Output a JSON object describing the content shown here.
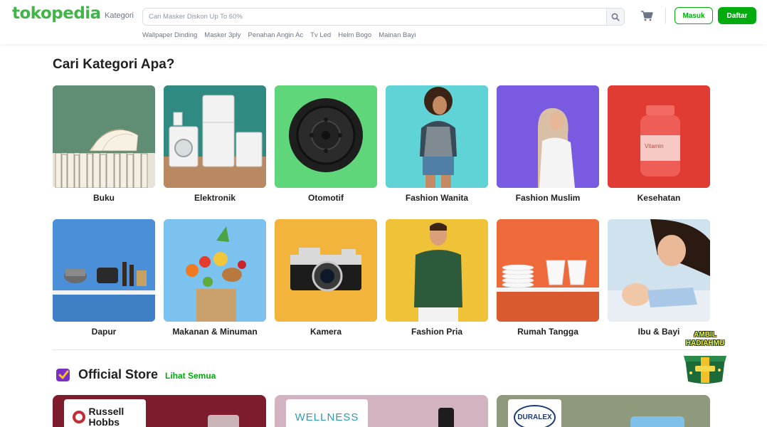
{
  "header": {
    "logo": "tokopedia",
    "kategori": "Kategori",
    "search_placeholder": "Cari Masker Diskon Up To 60%",
    "masuk": "Masuk",
    "daftar": "Daftar",
    "suggestions": [
      "Wallpaper Dinding",
      "Masker 3ply",
      "Penahan Angin Ac",
      "Tv Led",
      "Helm Bogo",
      "Mainan Bayi"
    ]
  },
  "section_title": "Cari Kategori Apa?",
  "categories": [
    {
      "label": "Buku",
      "bg": "#5a8a70"
    },
    {
      "label": "Elektronik",
      "bg": "#2f8a82"
    },
    {
      "label": "Otomotif",
      "bg": "#5fd67a"
    },
    {
      "label": "Fashion Wanita",
      "bg": "#5fd3d6"
    },
    {
      "label": "Fashion Muslim",
      "bg": "#7a5ae0"
    },
    {
      "label": "Kesehatan",
      "bg": "#e03c34"
    },
    {
      "label": "Dapur",
      "bg": "#4b8fd8"
    },
    {
      "label": "Makanan & Minuman",
      "bg": "#7cc2ee"
    },
    {
      "label": "Kamera",
      "bg": "#f2b43a"
    },
    {
      "label": "Fashion Pria",
      "bg": "#f0c238"
    },
    {
      "label": "Rumah Tangga",
      "bg": "#ee6a3a"
    },
    {
      "label": "Ibu & Bayi",
      "bg": "#cfe2ee"
    }
  ],
  "official_store": {
    "title": "Official Store",
    "link": "Lihat Semua",
    "stores": [
      {
        "brand": "Russell Hobbs",
        "bg": "#7d1c2c"
      },
      {
        "brand": "WELLNESS",
        "bg": "#d3b3c2"
      },
      {
        "brand": "DURALEX",
        "bg": "#8f9a7c"
      }
    ]
  },
  "widget": {
    "text": "AMBIL HADIAHMU"
  },
  "colors": {
    "brand": "#03ac0e",
    "logo": "#42b549"
  }
}
